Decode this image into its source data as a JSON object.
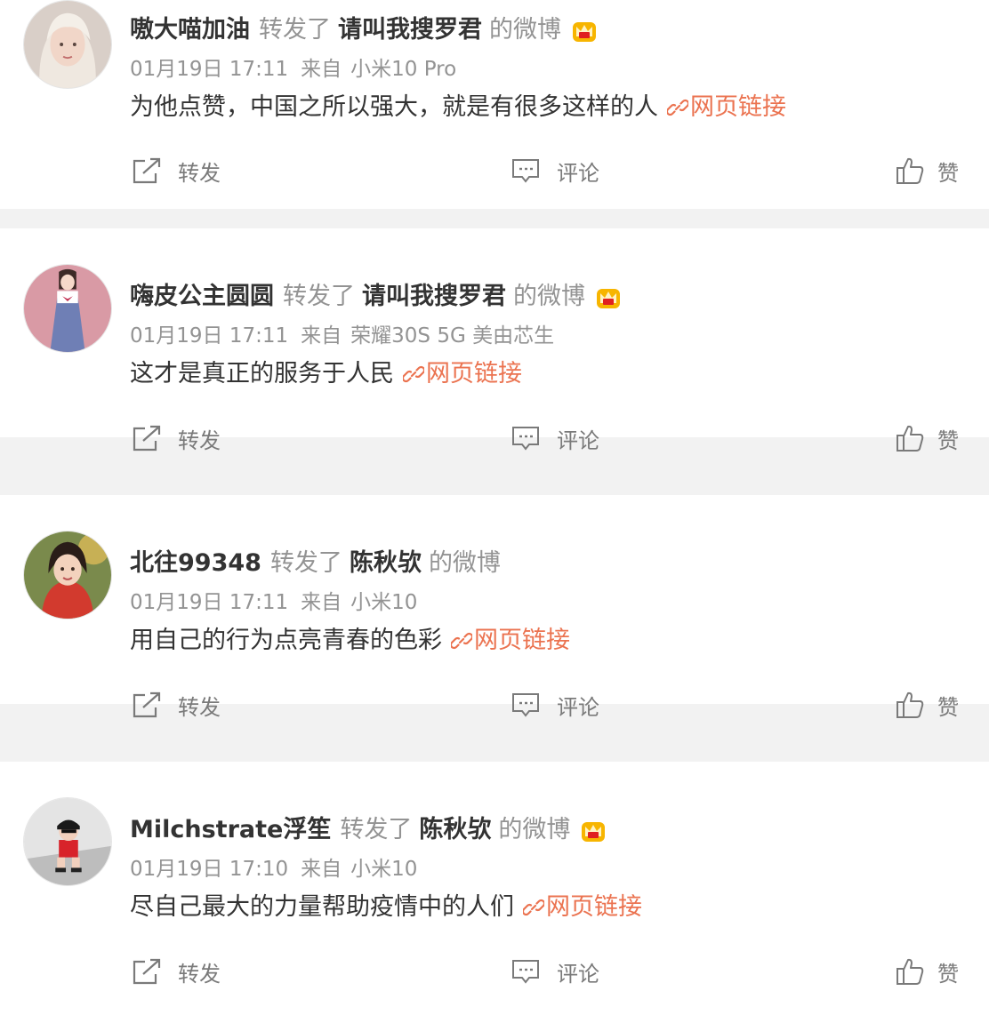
{
  "colors": {
    "name": "#333333",
    "secondary": "#939393",
    "link": "#eb7350",
    "action": "#7a7a7a",
    "separator": "#f2f2f2",
    "crown": "#f7b500"
  },
  "actions": {
    "repost_label": "转发",
    "comment_label": "评论",
    "like_label": "赞"
  },
  "posts": [
    {
      "username": "嗷大喵加油",
      "action": "转发了",
      "source_user": "请叫我搜罗君",
      "suffix": "的微博",
      "badge_icon": "crown-icon",
      "time": "01月19日 17:11",
      "source_label": "来自",
      "device": "小米10 Pro",
      "text": "为他点赞，中国之所以强大，就是有很多这样的人",
      "link_label": "网页链接"
    },
    {
      "username": "嗨皮公主圆圆",
      "action": "转发了",
      "source_user": "请叫我搜罗君",
      "suffix": "的微博",
      "badge_icon": "crown-icon",
      "time": "01月19日 17:11",
      "source_label": "来自",
      "device": "荣耀30S 5G 美由芯生",
      "text": "这才是真正的服务于人民",
      "link_label": "网页链接"
    },
    {
      "username": "北往99348",
      "action": "转发了",
      "source_user": "陈秋欤",
      "suffix": "的微博",
      "badge_icon": "",
      "time": "01月19日 17:11",
      "source_label": "来自",
      "device": "小米10",
      "text": "用自己的行为点亮青春的色彩",
      "link_label": "网页链接"
    },
    {
      "username": "Milchstrate浮笙",
      "action": "转发了",
      "source_user": "陈秋欤",
      "suffix": "的微博",
      "badge_icon": "crown-icon",
      "time": "01月19日 17:10",
      "source_label": "来自",
      "device": "小米10",
      "text": "尽自己最大的力量帮助疫情中的人们",
      "link_label": "网页链接"
    }
  ]
}
